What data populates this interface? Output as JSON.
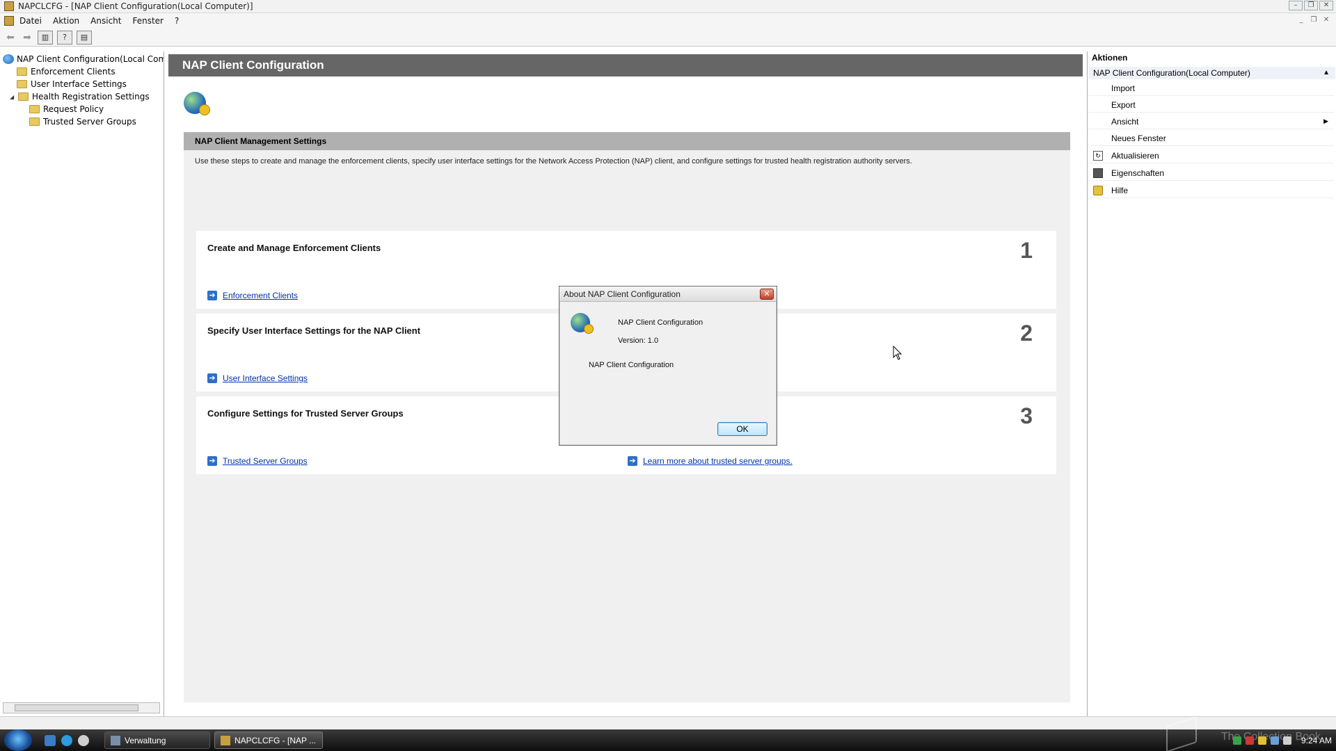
{
  "window": {
    "title": "NAPCLCFG - [NAP Client Configuration(Local Computer)]"
  },
  "menubar": {
    "items": [
      "Datei",
      "Aktion",
      "Ansicht",
      "Fenster",
      "?"
    ]
  },
  "tree": {
    "root": "NAP Client Configuration(Local Compu",
    "items": [
      {
        "label": "Enforcement Clients"
      },
      {
        "label": "User Interface Settings"
      },
      {
        "label": "Health Registration Settings"
      },
      {
        "label": "Request Policy"
      },
      {
        "label": "Trusted Server Groups"
      }
    ]
  },
  "center": {
    "header": "NAP Client Configuration",
    "section_title": "NAP Client Management Settings",
    "description": "Use these steps to create and manage the enforcement clients, specify user interface settings for the Network Access Protection (NAP) client, and configure settings for trusted health registration authority servers.",
    "cards": [
      {
        "title": "Create and Manage Enforcement Clients",
        "number": "1",
        "link": "Enforcement Clients"
      },
      {
        "title": "Specify User Interface Settings for the NAP Client",
        "number": "2",
        "link": "User Interface Settings"
      },
      {
        "title": "Configure Settings for Trusted Server Groups",
        "number": "3",
        "link": "Trusted Server Groups",
        "extra_link": "Learn more about trusted server groups."
      }
    ]
  },
  "actions": {
    "title": "Aktionen",
    "group": "NAP Client Configuration(Local Computer)",
    "items": [
      {
        "label": "Import",
        "icon": "none"
      },
      {
        "label": "Export",
        "icon": "none"
      },
      {
        "label": "Ansicht",
        "icon": "none",
        "submenu": true
      },
      {
        "label": "Neues Fenster",
        "icon": "none"
      },
      {
        "label": "Aktualisieren",
        "icon": "refresh-icon"
      },
      {
        "label": "Eigenschaften",
        "icon": "properties-icon"
      },
      {
        "label": "Hilfe",
        "icon": "help-icon"
      }
    ]
  },
  "dialog": {
    "title": "About NAP Client Configuration",
    "product": "NAP Client Configuration",
    "version": "Version: 1.0",
    "description": "NAP Client Configuration",
    "ok_label": "OK"
  },
  "taskbar": {
    "tasks": [
      {
        "label": "Verwaltung",
        "active": false
      },
      {
        "label": "NAPCLCFG - [NAP ...",
        "active": true
      }
    ],
    "clock": "9:24 AM",
    "watermark": "The Collection Book"
  }
}
